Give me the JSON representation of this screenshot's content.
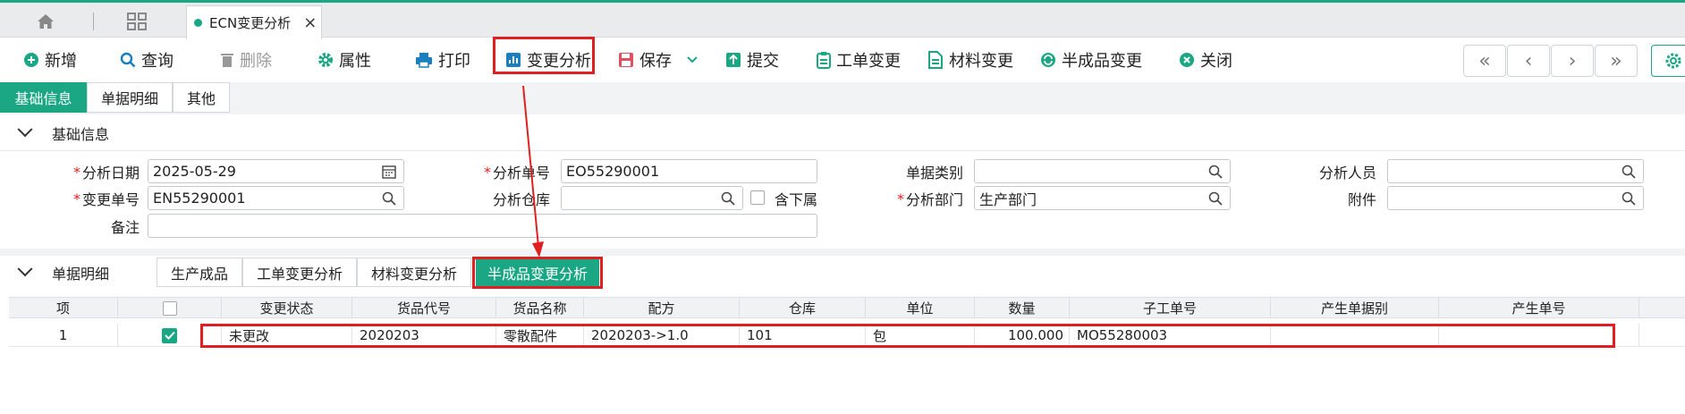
{
  "top_tabs": {
    "doc_tab": "ECN变更分析",
    "close": "×"
  },
  "toolbar": {
    "add": "新增",
    "query": "查询",
    "delete": "删除",
    "properties": "属性",
    "print": "打印",
    "change_analysis": "变更分析",
    "save": "保存",
    "submit": "提交",
    "work_order_change": "工单变更",
    "material_change": "材料变更",
    "semi_product_change": "半成品变更",
    "close": "关闭"
  },
  "nav": {
    "first": "«",
    "prev": "‹",
    "next": "›",
    "last": "»"
  },
  "main_tabs": [
    "基础信息",
    "单据明细",
    "其他"
  ],
  "basic_section": {
    "title": "基础信息"
  },
  "form": {
    "analysis_date_label": "分析日期",
    "analysis_date": "2025-05-29",
    "analysis_no_label": "分析单号",
    "analysis_no": "EO55290001",
    "doc_type_label": "单据类别",
    "doc_type": "",
    "analyst_label": "分析人员",
    "analyst": "",
    "change_no_label": "变更单号",
    "change_no": "EN55290001",
    "warehouse_label": "分析仓库",
    "warehouse": "",
    "include_sub_label": "含下属",
    "dept_label": "分析部门",
    "dept": "生产部门",
    "attachment_label": "附件",
    "attachment": "",
    "remark_label": "备注",
    "remark": ""
  },
  "detail_section": {
    "title": "单据明细"
  },
  "sub_tabs": [
    "生产成品",
    "工单变更分析",
    "材料变更分析",
    "半成品变更分析"
  ],
  "grid": {
    "headers": [
      "项",
      "",
      "变更状态",
      "货品代号",
      "货品名称",
      "配方",
      "仓库",
      "单位",
      "数量",
      "子工单号",
      "产生单据别",
      "产生单号"
    ],
    "rows": [
      {
        "item": "1",
        "status": "未更改",
        "code": "2020203",
        "name": "零散配件",
        "formula": "2020203->1.0",
        "warehouse": "101",
        "unit": "包",
        "qty": "100.000",
        "sub_order": "MO55280003",
        "gen_type": "",
        "gen_no": ""
      }
    ]
  },
  "colors": {
    "accent": "#1ba784",
    "highlight": "#e02020"
  }
}
